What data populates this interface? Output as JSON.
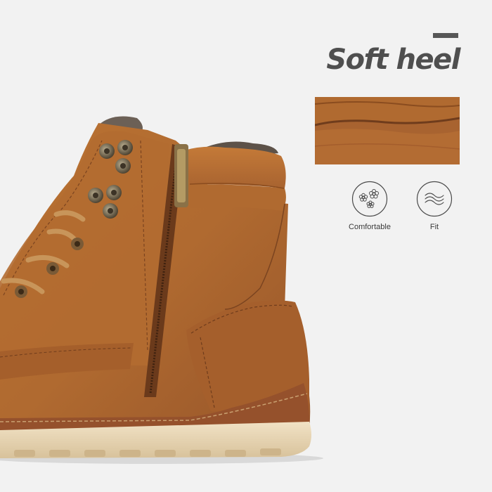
{
  "heading": {
    "title": "Soft heel"
  },
  "features": [
    {
      "label": "Comfortable",
      "icon": "flowers-icon"
    },
    {
      "label": "Fit",
      "icon": "waves-icon"
    }
  ],
  "colors": {
    "background": "#f2f2f2",
    "leather": "#b0682f",
    "leather_dark": "#8a4c1f",
    "sole_band": "#95512c",
    "outsole": "#ead8b8",
    "title": "#4f4f4f"
  }
}
